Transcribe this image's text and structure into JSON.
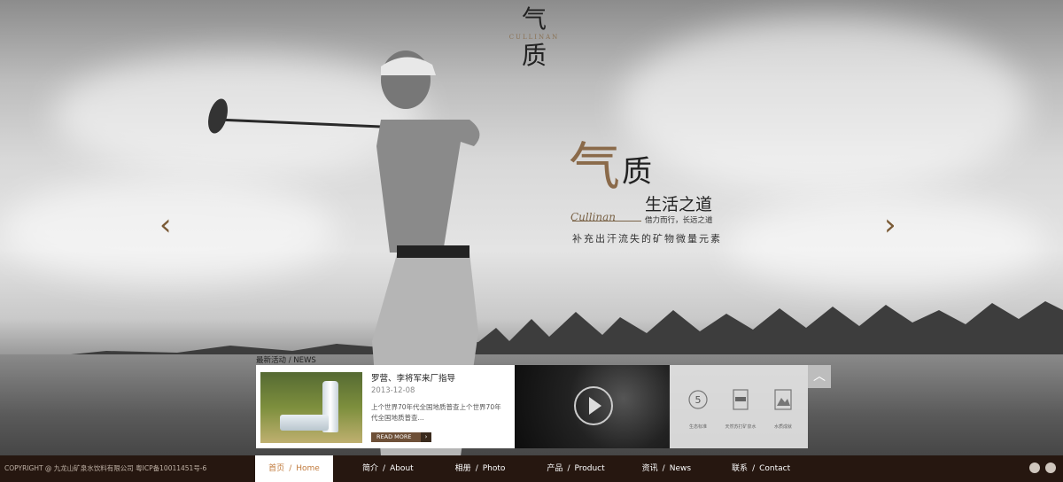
{
  "brand": {
    "logo_char_top": "气",
    "logo_latin": "CULLINAN",
    "logo_char_bottom": "质"
  },
  "slide": {
    "big_char_1": "气",
    "big_char_2": "质",
    "life_text": "生活之道",
    "subtitle": "借力而行，长远之道",
    "signature": "Cullinan",
    "slogan": "补充出汗流失的矿物微量元素"
  },
  "news": {
    "section_label": "最新活动 / NEWS",
    "title": "罗营、李将军来厂指导",
    "date": "2013-12-08",
    "description": "上个世界70年代全国地质普查上个世界70年代全国地质普查...",
    "more_label": "READ MORE",
    "more_arrow": "›"
  },
  "certs": [
    {
      "label": "生态标准",
      "icon": "badge-5-icon"
    },
    {
      "label": "天然苏打矿泉水",
      "icon": "soda-icon"
    },
    {
      "label": "水质成就",
      "icon": "mountain-icon"
    }
  ],
  "toggle_icon": "︿",
  "arrows": {
    "prev": "‹",
    "next": "›"
  },
  "footer": {
    "copyright": "COPYRIGHT @ 九龙山矿泉水饮料有限公司   粤ICP备10011451号-6",
    "nav": [
      {
        "cn": "首页",
        "en": "Home"
      },
      {
        "cn": "简介",
        "en": "About"
      },
      {
        "cn": "相册",
        "en": "Photo"
      },
      {
        "cn": "产品",
        "en": "Product"
      },
      {
        "cn": "资讯",
        "en": "News"
      },
      {
        "cn": "联系",
        "en": "Contact"
      }
    ]
  }
}
